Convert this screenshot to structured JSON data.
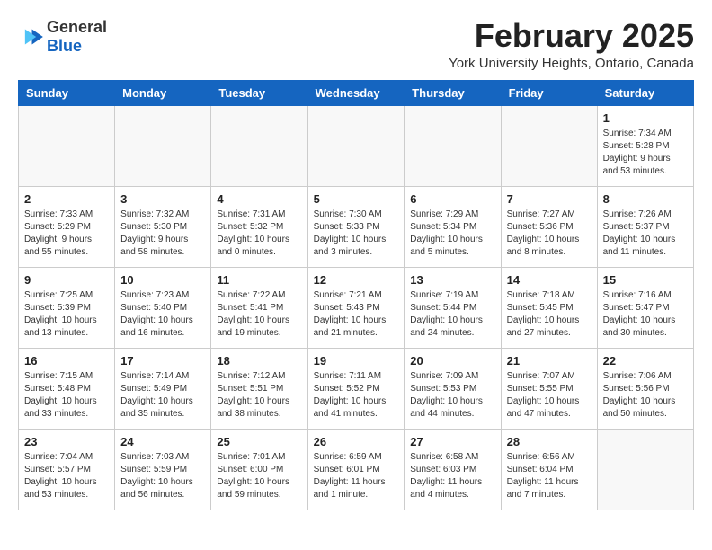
{
  "header": {
    "logo_general": "General",
    "logo_blue": "Blue",
    "month_year": "February 2025",
    "location": "York University Heights, Ontario, Canada"
  },
  "weekdays": [
    "Sunday",
    "Monday",
    "Tuesday",
    "Wednesday",
    "Thursday",
    "Friday",
    "Saturday"
  ],
  "weeks": [
    [
      {
        "day": "",
        "info": ""
      },
      {
        "day": "",
        "info": ""
      },
      {
        "day": "",
        "info": ""
      },
      {
        "day": "",
        "info": ""
      },
      {
        "day": "",
        "info": ""
      },
      {
        "day": "",
        "info": ""
      },
      {
        "day": "1",
        "info": "Sunrise: 7:34 AM\nSunset: 5:28 PM\nDaylight: 9 hours and 53 minutes."
      }
    ],
    [
      {
        "day": "2",
        "info": "Sunrise: 7:33 AM\nSunset: 5:29 PM\nDaylight: 9 hours and 55 minutes."
      },
      {
        "day": "3",
        "info": "Sunrise: 7:32 AM\nSunset: 5:30 PM\nDaylight: 9 hours and 58 minutes."
      },
      {
        "day": "4",
        "info": "Sunrise: 7:31 AM\nSunset: 5:32 PM\nDaylight: 10 hours and 0 minutes."
      },
      {
        "day": "5",
        "info": "Sunrise: 7:30 AM\nSunset: 5:33 PM\nDaylight: 10 hours and 3 minutes."
      },
      {
        "day": "6",
        "info": "Sunrise: 7:29 AM\nSunset: 5:34 PM\nDaylight: 10 hours and 5 minutes."
      },
      {
        "day": "7",
        "info": "Sunrise: 7:27 AM\nSunset: 5:36 PM\nDaylight: 10 hours and 8 minutes."
      },
      {
        "day": "8",
        "info": "Sunrise: 7:26 AM\nSunset: 5:37 PM\nDaylight: 10 hours and 11 minutes."
      }
    ],
    [
      {
        "day": "9",
        "info": "Sunrise: 7:25 AM\nSunset: 5:39 PM\nDaylight: 10 hours and 13 minutes."
      },
      {
        "day": "10",
        "info": "Sunrise: 7:23 AM\nSunset: 5:40 PM\nDaylight: 10 hours and 16 minutes."
      },
      {
        "day": "11",
        "info": "Sunrise: 7:22 AM\nSunset: 5:41 PM\nDaylight: 10 hours and 19 minutes."
      },
      {
        "day": "12",
        "info": "Sunrise: 7:21 AM\nSunset: 5:43 PM\nDaylight: 10 hours and 21 minutes."
      },
      {
        "day": "13",
        "info": "Sunrise: 7:19 AM\nSunset: 5:44 PM\nDaylight: 10 hours and 24 minutes."
      },
      {
        "day": "14",
        "info": "Sunrise: 7:18 AM\nSunset: 5:45 PM\nDaylight: 10 hours and 27 minutes."
      },
      {
        "day": "15",
        "info": "Sunrise: 7:16 AM\nSunset: 5:47 PM\nDaylight: 10 hours and 30 minutes."
      }
    ],
    [
      {
        "day": "16",
        "info": "Sunrise: 7:15 AM\nSunset: 5:48 PM\nDaylight: 10 hours and 33 minutes."
      },
      {
        "day": "17",
        "info": "Sunrise: 7:14 AM\nSunset: 5:49 PM\nDaylight: 10 hours and 35 minutes."
      },
      {
        "day": "18",
        "info": "Sunrise: 7:12 AM\nSunset: 5:51 PM\nDaylight: 10 hours and 38 minutes."
      },
      {
        "day": "19",
        "info": "Sunrise: 7:11 AM\nSunset: 5:52 PM\nDaylight: 10 hours and 41 minutes."
      },
      {
        "day": "20",
        "info": "Sunrise: 7:09 AM\nSunset: 5:53 PM\nDaylight: 10 hours and 44 minutes."
      },
      {
        "day": "21",
        "info": "Sunrise: 7:07 AM\nSunset: 5:55 PM\nDaylight: 10 hours and 47 minutes."
      },
      {
        "day": "22",
        "info": "Sunrise: 7:06 AM\nSunset: 5:56 PM\nDaylight: 10 hours and 50 minutes."
      }
    ],
    [
      {
        "day": "23",
        "info": "Sunrise: 7:04 AM\nSunset: 5:57 PM\nDaylight: 10 hours and 53 minutes."
      },
      {
        "day": "24",
        "info": "Sunrise: 7:03 AM\nSunset: 5:59 PM\nDaylight: 10 hours and 56 minutes."
      },
      {
        "day": "25",
        "info": "Sunrise: 7:01 AM\nSunset: 6:00 PM\nDaylight: 10 hours and 59 minutes."
      },
      {
        "day": "26",
        "info": "Sunrise: 6:59 AM\nSunset: 6:01 PM\nDaylight: 11 hours and 1 minute."
      },
      {
        "day": "27",
        "info": "Sunrise: 6:58 AM\nSunset: 6:03 PM\nDaylight: 11 hours and 4 minutes."
      },
      {
        "day": "28",
        "info": "Sunrise: 6:56 AM\nSunset: 6:04 PM\nDaylight: 11 hours and 7 minutes."
      },
      {
        "day": "",
        "info": ""
      }
    ]
  ]
}
